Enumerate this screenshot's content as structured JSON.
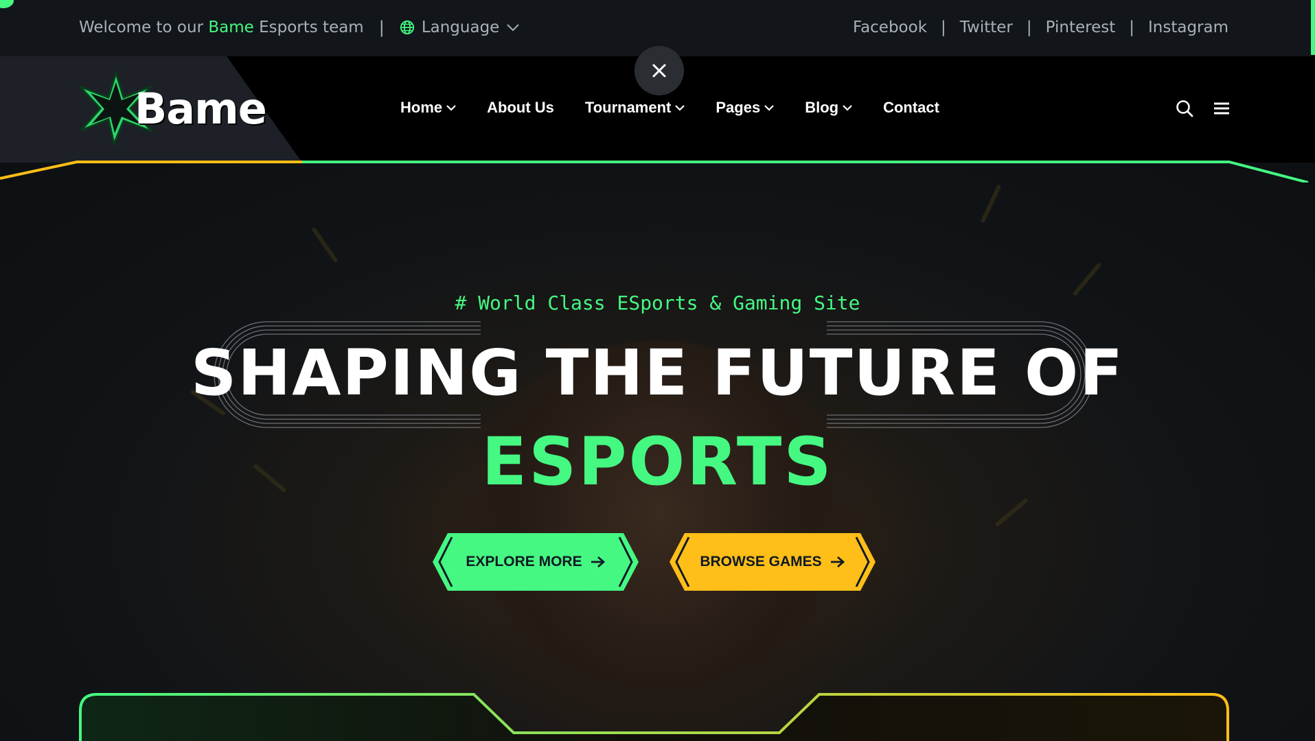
{
  "topbar": {
    "welcome_prefix": "Welcome to our",
    "brand": "Bame",
    "welcome_suffix": "Esports team",
    "language_label": "Language",
    "socials": [
      "Facebook",
      "Twitter",
      "Pinterest",
      "Instagram"
    ]
  },
  "header": {
    "logo_text": "Bame",
    "nav": [
      {
        "label": "Home",
        "dropdown": true
      },
      {
        "label": "About Us",
        "dropdown": false
      },
      {
        "label": "Tournament",
        "dropdown": true
      },
      {
        "label": "Pages",
        "dropdown": true
      },
      {
        "label": "Blog",
        "dropdown": true
      },
      {
        "label": "Contact",
        "dropdown": false
      }
    ],
    "icons": [
      "search-icon",
      "menu-icon",
      "close-icon"
    ]
  },
  "hero": {
    "tagline": "# World Class ESports & Gaming Site",
    "title_line1": "SHAPING THE FUTURE OF",
    "title_line2": "ESPORTS",
    "buttons": {
      "explore": "EXPLORE MORE",
      "browse": "BROWSE GAMES"
    }
  },
  "colors": {
    "accent_green": "#45f882",
    "accent_yellow": "#ffbe18",
    "topbar_bg": "#12161a",
    "header_bg": "#000000",
    "muted_text": "#a9b0b8"
  }
}
